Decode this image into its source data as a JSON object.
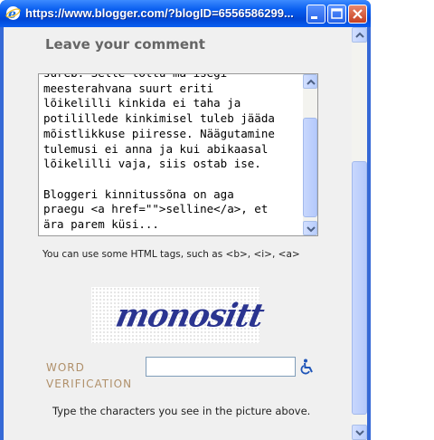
{
  "window": {
    "title": "https://www.blogger.com/?blogID=6556586299...",
    "browser_icon": "internet-explorer-icon",
    "controls": [
      "minimize-icon",
      "maximize-icon",
      "close-icon"
    ]
  },
  "comment_form": {
    "heading": "Leave your comment",
    "comment_text": "sureb. Selle tõttu ma isegi\nmeesterahvana suurt eriti\nlõikelilli kinkida ei taha ja\npotilillede kinkimisel tuleb jääda\nmõistlikkuse piiresse. Näägutamine\ntulemusi ei anna ja kui abikaasal\nlõikelilli vaja, siis ostab ise.\n\nBloggeri kinnitussõna on aga\npraegu <a href=\"\">selline</a>, et\nära parem küsi...",
    "html_hint": "You can use some HTML tags, such as <b>, <i>, <a>"
  },
  "verification": {
    "captcha_word": "monositt",
    "label_line1": "WORD",
    "label_line2": "VERIFICATION",
    "input_value": "",
    "accessibility_icon": "wheelchair-accessibility-icon",
    "instructions": "Type the characters you see in the picture above."
  },
  "colors": {
    "titlebar": "#0a5ff0",
    "label_brown": "#b0906a",
    "captcha_blue": "#2a3490"
  }
}
